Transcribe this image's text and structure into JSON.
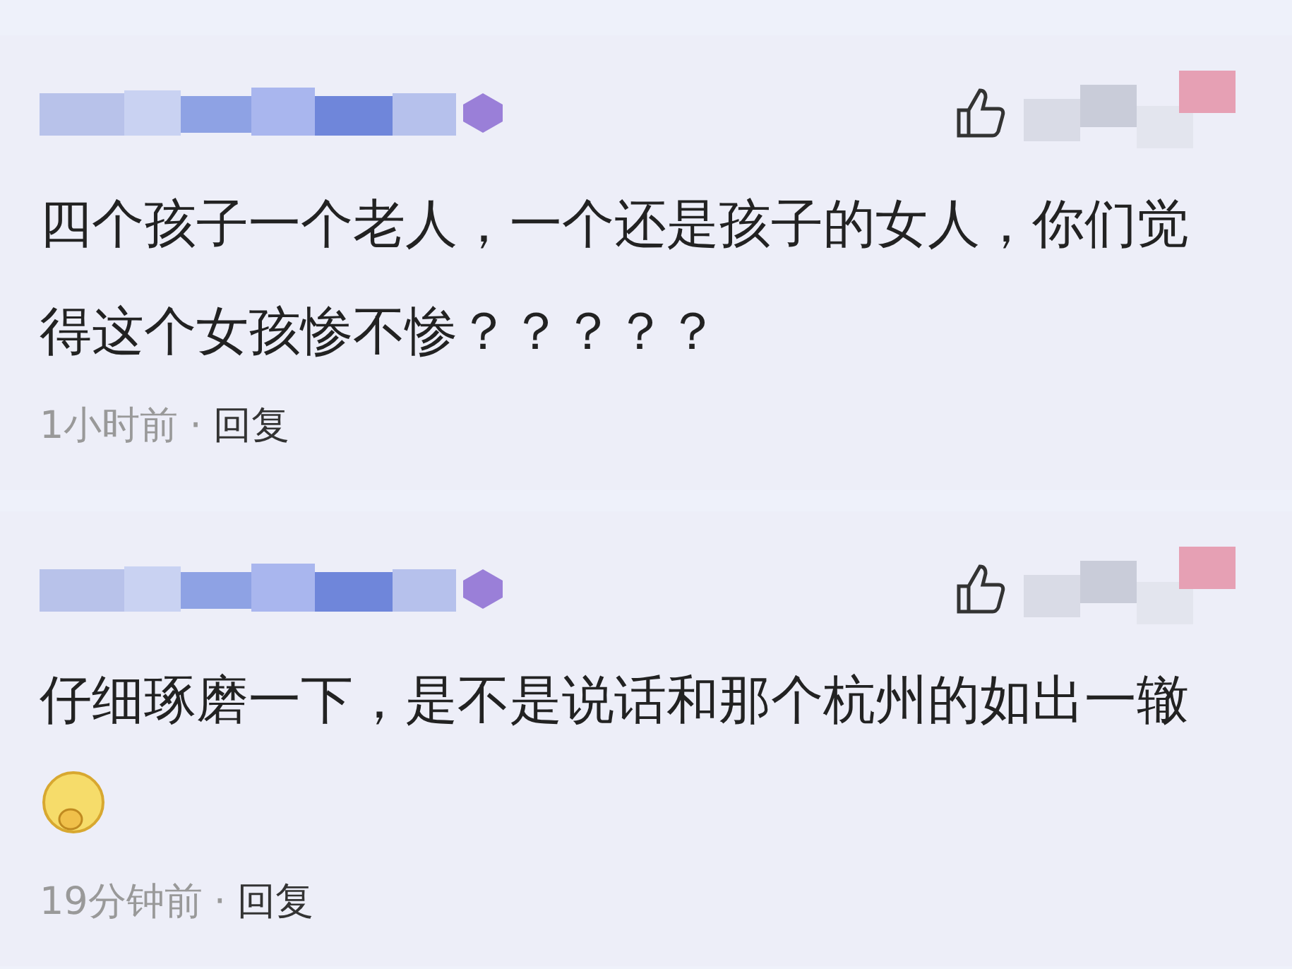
{
  "comments": [
    {
      "text": "四个孩子一个老人，一个还是孩子的女人，你们觉得这个女孩惨不惨？？？？？",
      "has_emoji": false,
      "time": "1小时前",
      "separator": "·",
      "reply": "回复"
    },
    {
      "text": "仔细琢磨一下，是不是说话和那个杭州的如出一辙",
      "has_emoji": true,
      "time": "19分钟前",
      "separator": "·",
      "reply": "回复"
    }
  ]
}
